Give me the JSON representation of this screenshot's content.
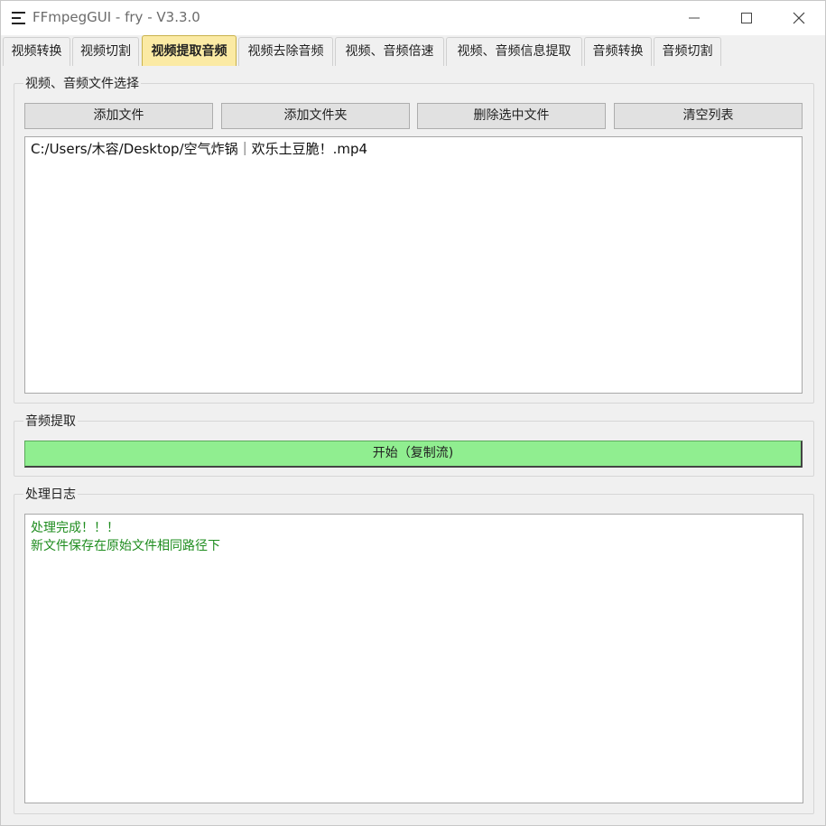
{
  "window": {
    "title": "FFmpegGUI - fry - V3.3.0",
    "icons": {
      "app": "menu-icon",
      "minimize": "minimize-icon",
      "maximize": "maximize-icon",
      "close": "close-icon"
    }
  },
  "tabs": [
    {
      "label": "视频转换",
      "active": false
    },
    {
      "label": "视频切割",
      "active": false
    },
    {
      "label": "视频提取音频",
      "active": true
    },
    {
      "label": "视频去除音频",
      "active": false
    },
    {
      "label": "视频、音频倍速",
      "active": false
    },
    {
      "label": "视频、音频信息提取",
      "active": false
    },
    {
      "label": "音频转换",
      "active": false
    },
    {
      "label": "音频切割",
      "active": false
    }
  ],
  "file_section": {
    "title": "视频、音频文件选择",
    "buttons": {
      "add_file": "添加文件",
      "add_folder": "添加文件夹",
      "delete_selected": "删除选中文件",
      "clear_list": "清空列表"
    },
    "files": [
      "C:/Users/木容/Desktop/空气炸锅｜欢乐土豆脆！.mp4"
    ]
  },
  "extract_section": {
    "title": "音频提取",
    "start_label": "开始（复制流)",
    "start_color": "#90ee90"
  },
  "log_section": {
    "title": "处理日志",
    "lines": [
      "处理完成！！！",
      "新文件保存在原始文件相同路径下"
    ],
    "text_color": "#1e8c1e"
  },
  "colors": {
    "active_tab": "#fbeaa4",
    "background": "#f0f0f0"
  }
}
